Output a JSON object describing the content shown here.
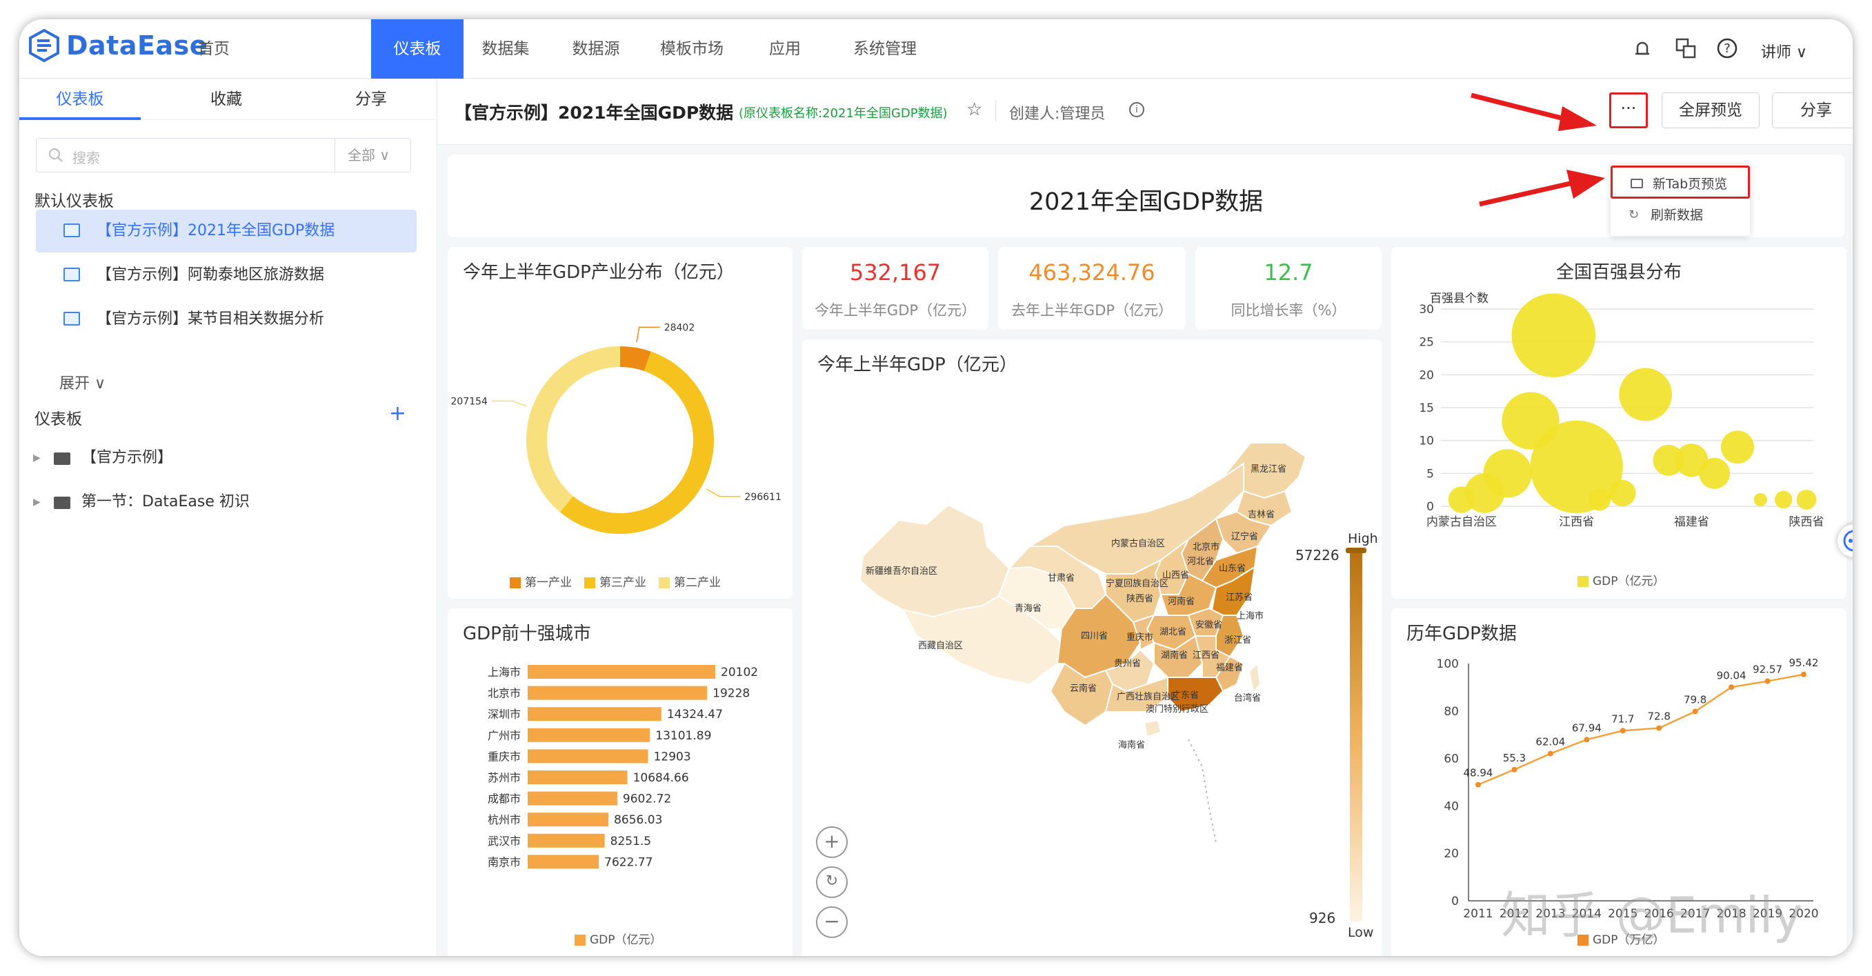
{
  "app": {
    "logo": "DataEase"
  },
  "nav": {
    "items": [
      "首页",
      "仪表板",
      "数据集",
      "数据源",
      "模板市场",
      "应用",
      "系统管理"
    ],
    "active": "仪表板",
    "user": "讲师 ∨"
  },
  "sidebar": {
    "tabs": [
      "仪表板",
      "收藏",
      "分享"
    ],
    "search_placeholder": "搜索",
    "search_filter": "全部 ∨",
    "default_title": "默认仪表板",
    "default_items": [
      "【官方示例】2021年全国GDP数据",
      "【官方示例】阿勒泰地区旅游数据",
      "【官方示例】某节目相关数据分析"
    ],
    "expand": "展开 ∨",
    "dash_title": "仪表板",
    "plus": "+",
    "folders": [
      "【官方示例】",
      "第一节：DataEase 初识"
    ]
  },
  "header": {
    "title": "【官方示例】2021年全国GDP数据",
    "subtitle": "(原仪表板名称:2021年全国GDP数据)",
    "creator": "创建人:管理员",
    "info": "i",
    "more": "···",
    "fullscreen": "全屏预览",
    "share": "分享",
    "menu": [
      "新Tab页预览",
      "刷新数据"
    ]
  },
  "dashboard": {
    "title": "2021年全国GDP数据",
    "donut": {
      "title": "今年上半年GDP产业分布（亿元）"
    },
    "kpis": [
      {
        "value": "532,167",
        "label": "今年上半年GDP（亿元）",
        "color": "#e8332f"
      },
      {
        "value": "463,324.76",
        "label": "去年上半年GDP（亿元）",
        "color": "#f28c28"
      },
      {
        "value": "12.7",
        "label": "同比增长率（%）",
        "color": "#3cbf4e"
      }
    ],
    "map": {
      "title": "今年上半年GDP（亿元）",
      "high_label": "High",
      "low_label": "Low",
      "max": "57226",
      "min": "926",
      "labels": [
        "新疆维吾尔自治区",
        "西藏自治区",
        "青海省",
        "甘肃省",
        "内蒙古自治区",
        "黑龙江省",
        "吉林省",
        "辽宁省",
        "北京市",
        "河北省",
        "山西省",
        "宁夏回族自治区",
        "陕西省",
        "河南省",
        "山东省",
        "江苏省",
        "安徽省",
        "湖北省",
        "上海市",
        "浙江省",
        "四川省",
        "重庆市",
        "贵州省",
        "湖南省",
        "江西省",
        "福建省",
        "云南省",
        "广西壮族自治区",
        "广东省",
        "台湾省",
        "海南省",
        "澳门特别行政区"
      ]
    },
    "bubble": {
      "title": "全国百强县分布",
      "ylabel": "百强县个数",
      "legend": "GDP（亿元）"
    },
    "hbar": {
      "title": "GDP前十强城市",
      "legend": "GDP（亿元）"
    },
    "line": {
      "title": "历年GDP数据",
      "legend": "GDP（万亿）"
    }
  },
  "watermark": "知乎 @Emily",
  "chart_data": [
    {
      "type": "pie",
      "variant": "donut",
      "title": "今年上半年GDP产业分布（亿元）",
      "categories": [
        "第一产业",
        "第三产业",
        "第二产业"
      ],
      "values": [
        28402,
        296611,
        207154
      ],
      "colors": [
        "#ed8a14",
        "#f5c21e",
        "#f9e07e"
      ]
    },
    {
      "type": "scatter",
      "variant": "bubble",
      "title": "全国百强县分布",
      "ylabel": "百强县个数",
      "ylim": [
        0,
        30
      ],
      "yticks": [
        0,
        5,
        10,
        15,
        20,
        25,
        30
      ],
      "xticks": [
        "内蒙古自治区",
        "江西省",
        "福建省",
        "陕西省"
      ],
      "legend": "GDP（亿元）",
      "points": [
        [
          0,
          1
        ],
        [
          1,
          2
        ],
        [
          2,
          5
        ],
        [
          3,
          13
        ],
        [
          4,
          26
        ],
        [
          5,
          6
        ],
        [
          6,
          1
        ],
        [
          7,
          2
        ],
        [
          8,
          17
        ],
        [
          9,
          7
        ],
        [
          10,
          7
        ],
        [
          11,
          5
        ],
        [
          12,
          9
        ],
        [
          13,
          1
        ],
        [
          14,
          1
        ],
        [
          15,
          1
        ]
      ],
      "sizes": [
        12,
        18,
        22,
        26,
        38,
        42,
        10,
        12,
        24,
        14,
        15,
        14,
        15,
        6,
        8,
        9
      ]
    },
    {
      "type": "bar",
      "orientation": "horizontal",
      "title": "GDP前十强城市",
      "categories": [
        "上海市",
        "北京市",
        "深圳市",
        "广州市",
        "重庆市",
        "苏州市",
        "成都市",
        "杭州市",
        "武汉市",
        "南京市"
      ],
      "values": [
        20102,
        19228,
        14324.47,
        13101.89,
        12903,
        10684.66,
        9602.72,
        8656.03,
        8251.5,
        7622.77
      ],
      "legend": "GDP（亿元）"
    },
    {
      "type": "line",
      "title": "历年GDP数据",
      "x": [
        "2011",
        "2012",
        "2013",
        "2014",
        "2015",
        "2016",
        "2017",
        "2018",
        "2019",
        "2020"
      ],
      "values": [
        48.94,
        55.3,
        62.04,
        67.94,
        71.7,
        72.8,
        79.8,
        90.04,
        92.57,
        95.42
      ],
      "ylim": [
        0,
        100
      ],
      "yticks": [
        0,
        20,
        40,
        60,
        80,
        100
      ],
      "legend": "GDP（万亿）"
    }
  ]
}
